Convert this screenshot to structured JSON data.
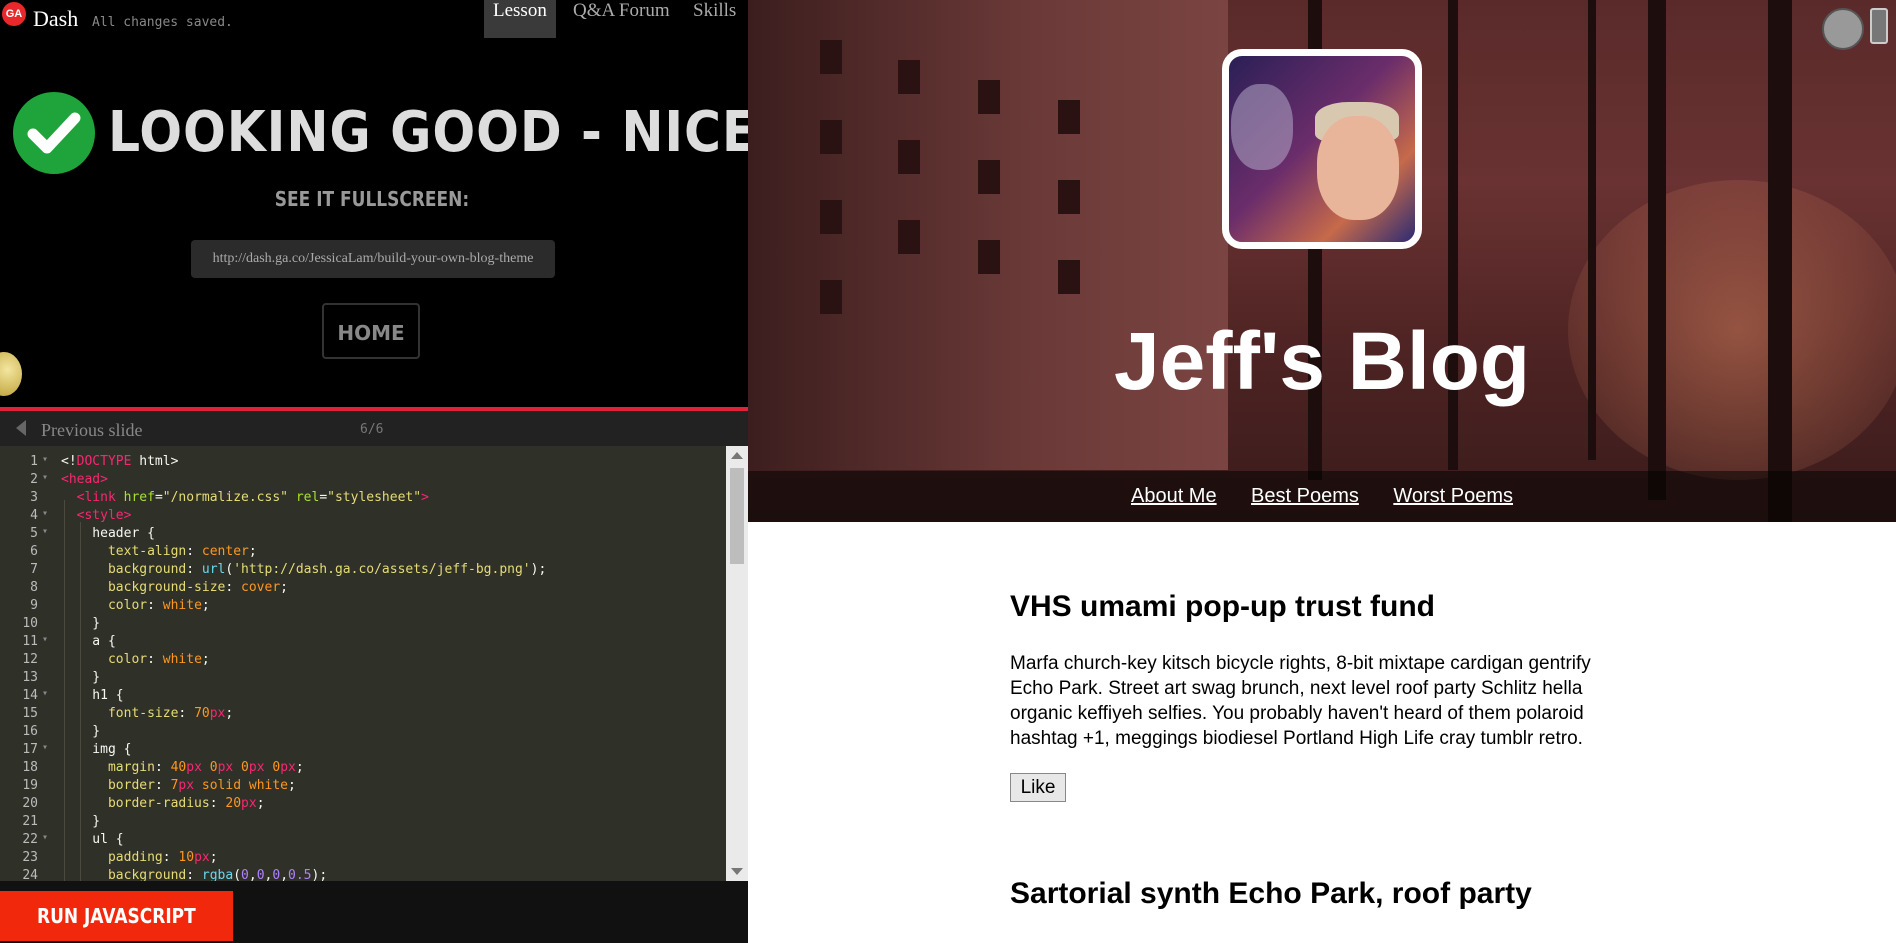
{
  "app": {
    "brand": "Dash",
    "logo_text": "GA",
    "save_status": "All changes saved.",
    "tabs": [
      {
        "label": "Lesson",
        "active": true
      },
      {
        "label": "Q&A Forum",
        "active": false
      },
      {
        "label": "Skills",
        "active": false
      }
    ]
  },
  "lesson_done": {
    "title": "LOOKING GOOD - NICE WORK!",
    "fullscreen_label": "SEE IT FULLSCREEN:",
    "url": "http://dash.ga.co/JessicaLam/build-your-own-blog-theme",
    "home_label": "HOME"
  },
  "slide_nav": {
    "prev_label": "Previous slide",
    "count": "6/6"
  },
  "editor": {
    "run_label": "RUN JAVASCRIPT"
  },
  "blog": {
    "title": "Jeff's Blog",
    "nav": [
      "About Me",
      "Best Poems",
      "Worst Poems"
    ],
    "posts": [
      {
        "title": "VHS umami pop-up trust fund",
        "body_lines": [
          "Marfa church-key kitsch bicycle rights, 8-bit mixtape cardigan gentrify",
          "Echo Park. Street art swag brunch, next level roof party Schlitz hella",
          "organic keffiyeh selfies. You probably haven't heard of them polaroid",
          "hashtag +1, meggings biodiesel Portland High Life cray tumblr retro."
        ],
        "like_label": "Like"
      },
      {
        "title": "Sartorial synth Echo Park, roof party"
      }
    ]
  },
  "colors": {
    "accent_red": "#e0233a",
    "run_button": "#f2280c",
    "check_green": "#1fa33b",
    "editor_bg": "#2f3129"
  }
}
